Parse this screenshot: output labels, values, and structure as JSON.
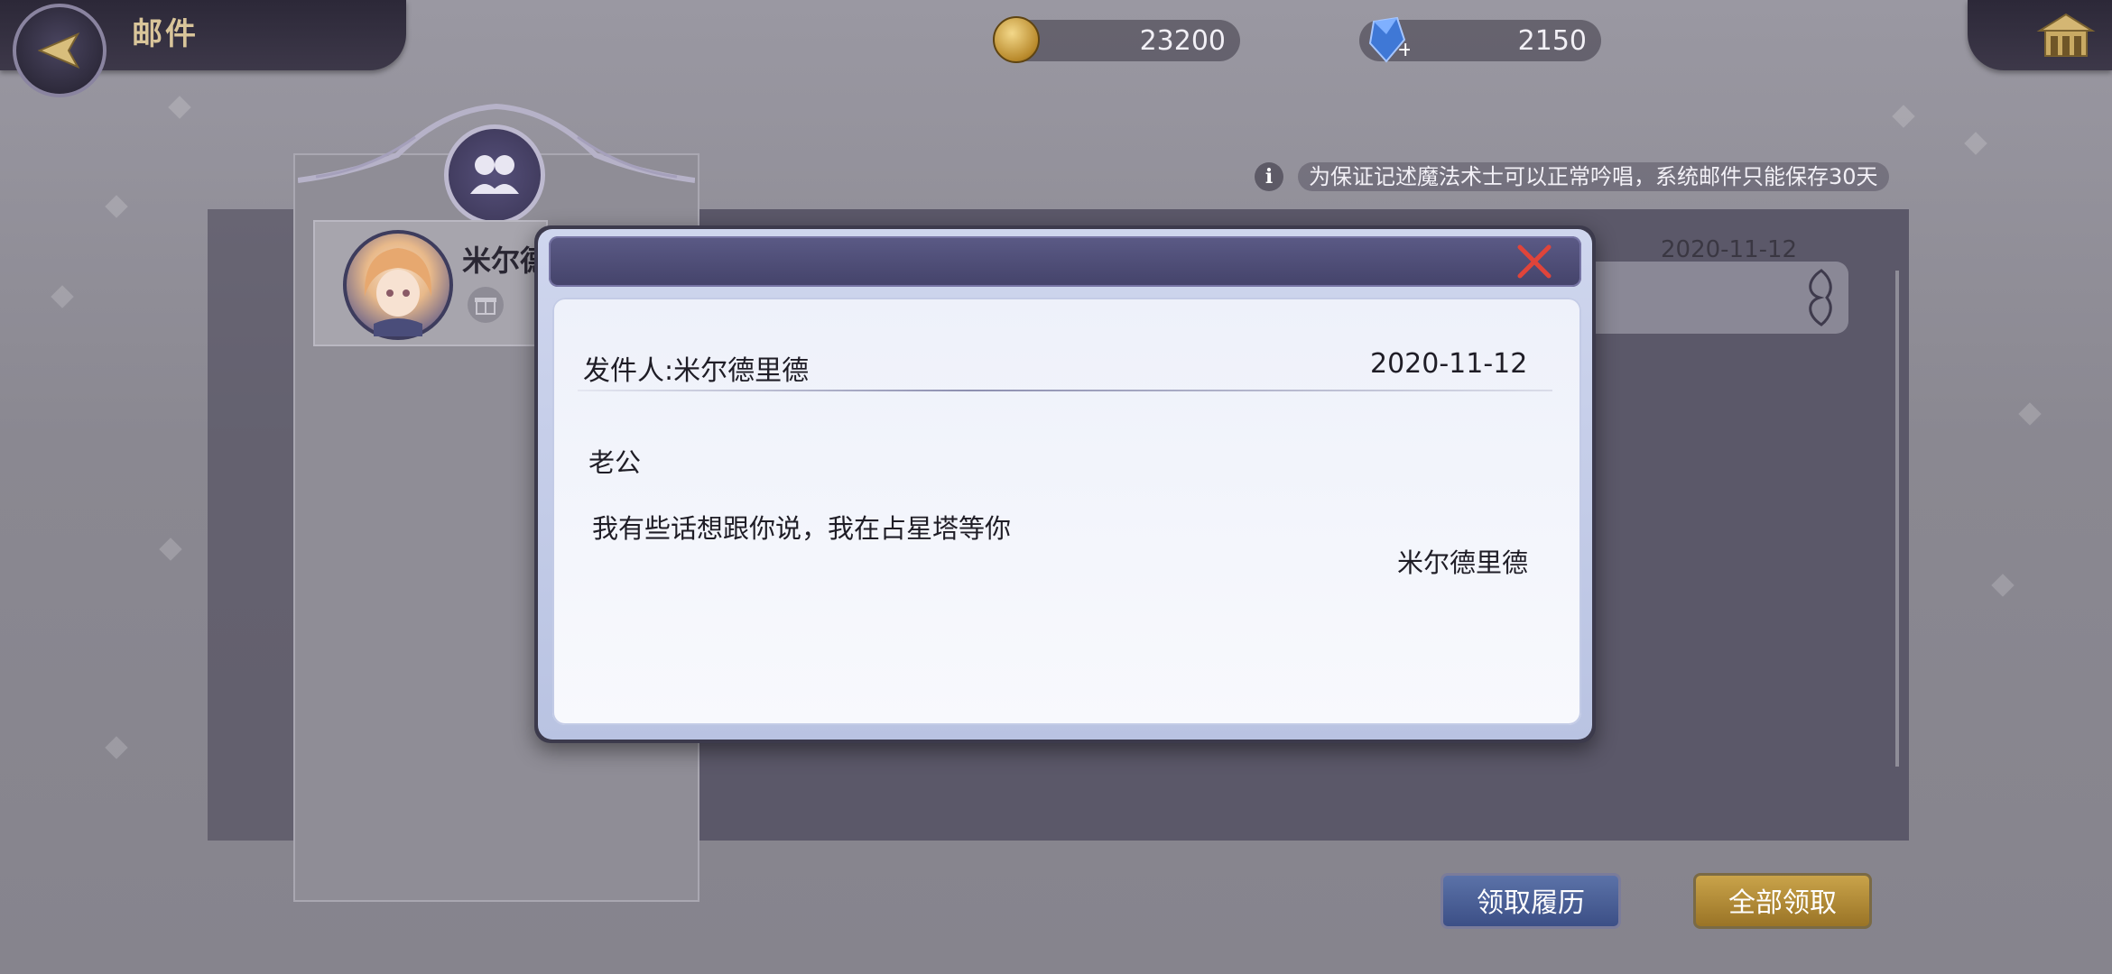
{
  "header": {
    "title": "邮件",
    "gold": "23200",
    "gems": "2150"
  },
  "notice": {
    "info_glyph": "i",
    "text": "为保证记述魔法术士可以正常吟唱，系统邮件只能保存30天"
  },
  "mail_list": {
    "items": [
      {
        "sender_preview": "米尔德",
        "date": "2020-11-12",
        "icon": "gift-icon"
      }
    ]
  },
  "buttons": {
    "history": "领取履历",
    "claim_all": "全部领取"
  },
  "modal": {
    "sender_label": "发件人:米尔德里德",
    "date": "2020-11-12",
    "greeting": "老公",
    "body": "我有些话想跟你说，我在占星塔等你",
    "signature": "米尔德里德",
    "close_icon": "close-icon"
  },
  "colors": {
    "title_gold": "#d9c59a",
    "close_red": "#e0443a",
    "history_blue": "#4a5e96",
    "claim_gold": "#b58d36"
  }
}
